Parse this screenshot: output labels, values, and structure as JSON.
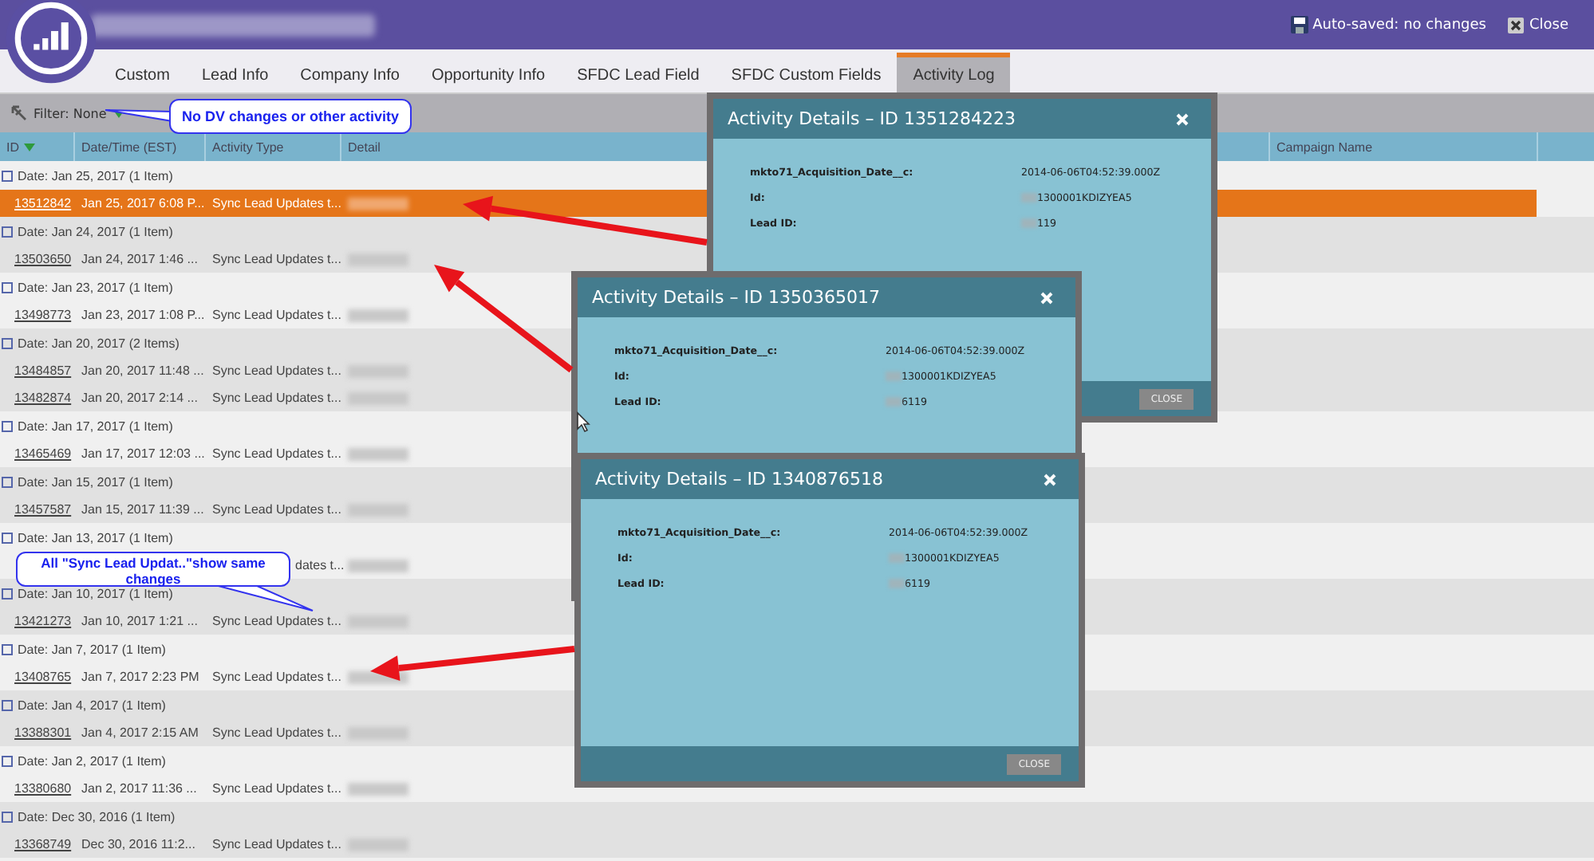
{
  "header": {
    "auto_saved": "Auto-saved: no changes",
    "close": "Close"
  },
  "tabs": [
    {
      "label": "Custom",
      "selected": false
    },
    {
      "label": "Lead Info",
      "selected": false
    },
    {
      "label": "Company Info",
      "selected": false
    },
    {
      "label": "Opportunity Info",
      "selected": false
    },
    {
      "label": "SFDC Lead Field",
      "selected": false
    },
    {
      "label": "SFDC Custom Fields",
      "selected": false
    },
    {
      "label": "Activity Log",
      "selected": true
    }
  ],
  "filter": {
    "label": "Filter: None"
  },
  "table": {
    "columns": [
      "ID",
      "Date/Time (EST)",
      "Activity Type",
      "Detail",
      "Campaign Name"
    ],
    "groups": [
      {
        "label": "Date: Jan 25, 2017 (1 Item)",
        "rows": [
          {
            "id": "13512842",
            "date": "Jan 25, 2017 6:08 P...",
            "type": "Sync Lead Updates t...",
            "selected": true
          }
        ]
      },
      {
        "label": "Date: Jan 24, 2017 (1 Item)",
        "rows": [
          {
            "id": "13503650",
            "date": "Jan 24, 2017 1:46 ...",
            "type": "Sync Lead Updates t...",
            "selected": false
          }
        ]
      },
      {
        "label": "Date: Jan 23, 2017 (1 Item)",
        "rows": [
          {
            "id": "13498773",
            "date": "Jan 23, 2017 1:08 P...",
            "type": "Sync Lead Updates t...",
            "selected": false
          }
        ]
      },
      {
        "label": "Date: Jan 20, 2017 (2 Items)",
        "rows": [
          {
            "id": "13484857",
            "date": "Jan 20, 2017 11:48 ...",
            "type": "Sync Lead Updates t...",
            "selected": false
          },
          {
            "id": "13482874",
            "date": "Jan 20, 2017 2:14 ...",
            "type": "Sync Lead Updates t...",
            "selected": false
          }
        ]
      },
      {
        "label": "Date: Jan 17, 2017 (1 Item)",
        "rows": [
          {
            "id": "13465469",
            "date": "Jan 17, 2017 12:03 ...",
            "type": "Sync Lead Updates t...",
            "selected": false
          }
        ]
      },
      {
        "label": "Date: Jan 15, 2017 (1 Item)",
        "rows": [
          {
            "id": "13457587",
            "date": "Jan 15, 2017 11:39 ...",
            "type": "Sync Lead Updates t...",
            "selected": false
          }
        ]
      },
      {
        "label": "Date: Jan 13, 2017 (1 Item)",
        "rows": [
          {
            "id": "",
            "date": "",
            "type": "dates t...",
            "selected": false
          }
        ]
      },
      {
        "label": "Date: Jan 10, 2017 (1 Item)",
        "rows": [
          {
            "id": "13421273",
            "date": "Jan 10, 2017 1:21 ...",
            "type": "Sync Lead Updates t...",
            "selected": false
          }
        ]
      },
      {
        "label": "Date: Jan 7, 2017 (1 Item)",
        "rows": [
          {
            "id": "13408765",
            "date": "Jan 7, 2017 2:23 PM",
            "type": "Sync Lead Updates t...",
            "selected": false
          }
        ]
      },
      {
        "label": "Date: Jan 4, 2017 (1 Item)",
        "rows": [
          {
            "id": "13388301",
            "date": "Jan 4, 2017 2:15 AM",
            "type": "Sync Lead Updates t...",
            "selected": false
          }
        ]
      },
      {
        "label": "Date: Jan 2, 2017 (1 Item)",
        "rows": [
          {
            "id": "13380680",
            "date": "Jan 2, 2017 11:36 ...",
            "type": "Sync Lead Updates t...",
            "selected": false
          }
        ]
      },
      {
        "label": "Date: Dec 30, 2016 (1 Item)",
        "rows": [
          {
            "id": "13368749",
            "date": "Dec 30, 2016 11:2...",
            "type": "Sync Lead Updates t...",
            "selected": false
          }
        ]
      }
    ]
  },
  "dialogs": [
    {
      "title": "Activity Details – ID 1351284223",
      "close": "CLOSE",
      "fields": [
        {
          "label": "mkto71_Acquisition_Date__c:",
          "value": "2014-06-06T04:52:39.000Z",
          "masked": false
        },
        {
          "label": "Id:",
          "value": "1300001KDIZYEA5",
          "masked": true
        },
        {
          "label": "Lead ID:",
          "value": "119",
          "masked": true
        }
      ]
    },
    {
      "title": "Activity Details – ID 1350365017",
      "fields": [
        {
          "label": "mkto71_Acquisition_Date__c:",
          "value": "2014-06-06T04:52:39.000Z",
          "masked": false
        },
        {
          "label": "Id:",
          "value": "1300001KDIZYEA5",
          "masked": true
        },
        {
          "label": "Lead ID:",
          "value": "6119",
          "masked": true
        }
      ]
    },
    {
      "title": "Activity Details – ID 1340876518",
      "close": "CLOSE",
      "fields": [
        {
          "label": "mkto71_Acquisition_Date__c:",
          "value": "2014-06-06T04:52:39.000Z",
          "masked": false
        },
        {
          "label": "Id:",
          "value": "1300001KDIZYEA5",
          "masked": true
        },
        {
          "label": "Lead ID:",
          "value": "6119",
          "masked": true
        }
      ]
    }
  ],
  "callouts": [
    {
      "text": "No DV changes or other activity"
    },
    {
      "text": "All \"Sync Lead Updat..\"show same changes"
    }
  ]
}
